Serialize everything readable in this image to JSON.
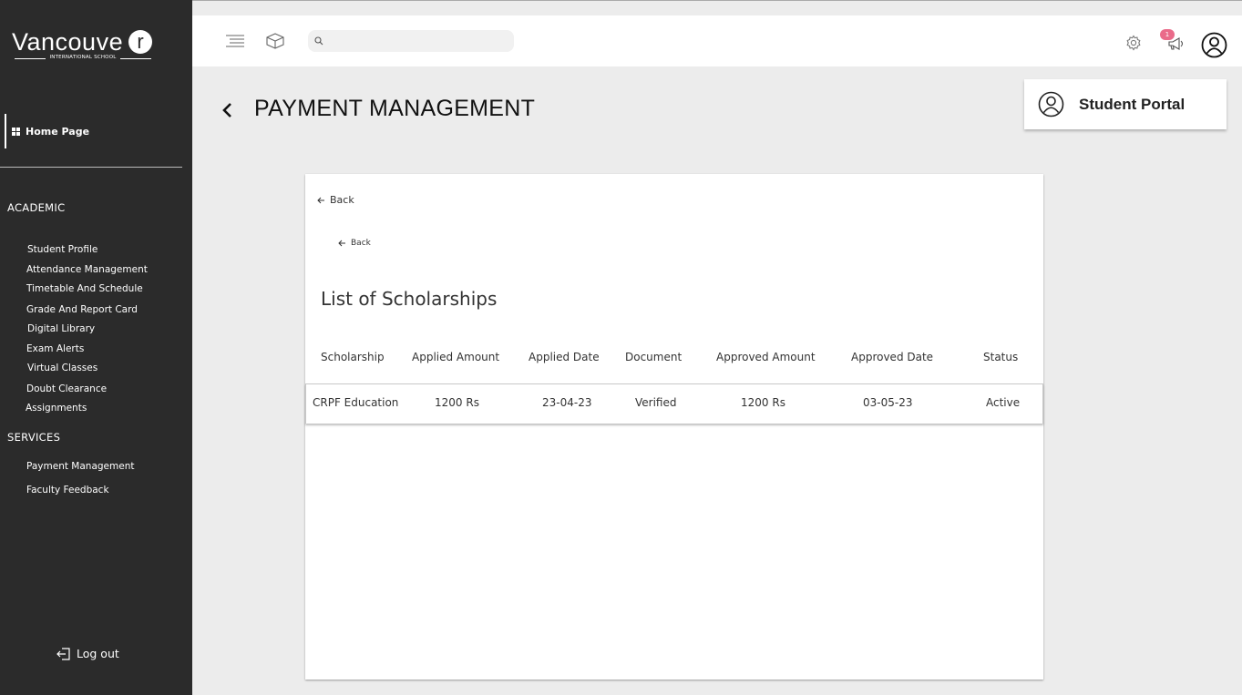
{
  "sidebar": {
    "logo": {
      "word": "Vancouve",
      "letter": "r",
      "subtitle": "INTERNATIONAL SCHOOL"
    },
    "home": "Home Page",
    "academic_title": "ACADEMIC",
    "academic_items": [
      "Student Profile",
      "Attendance Management",
      "Timetable And Schedule",
      "Grade And Report Card",
      "Digital Library",
      "Exam Alerts",
      "Virtual Classes",
      "Doubt Clearance",
      "Assignments"
    ],
    "services_title": "SERVICES",
    "services_items": [
      "Payment Management",
      "Faculty Feedback"
    ],
    "logout": "Log out"
  },
  "topbar": {
    "search_placeholder": "",
    "notification_count": "1"
  },
  "page": {
    "title": "PAYMENT MANAGEMENT",
    "portal_label": "Student Portal"
  },
  "card": {
    "back_label_1": "Back",
    "back_label_2": "Back",
    "title": "List of Scholarships",
    "columns": [
      "Scholarship",
      "Applied Amount",
      "Applied Date",
      "Document",
      "Approved Amount",
      "Approved Date",
      "Status"
    ],
    "rows": [
      [
        "CRPF Education",
        "1200 Rs",
        "23-04-23",
        "Verified",
        "1200 Rs",
        "03-05-23",
        "Active"
      ]
    ]
  }
}
